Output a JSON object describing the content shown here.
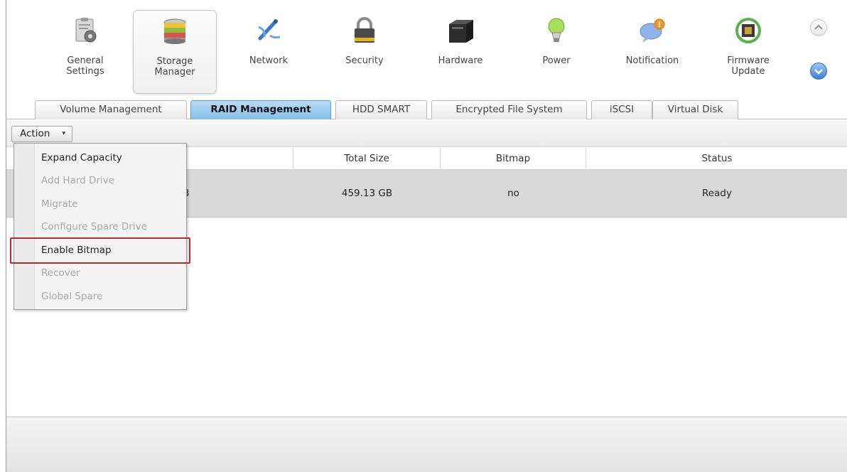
{
  "toolbar": {
    "items": [
      {
        "label": "General\nSettings",
        "icon": "settings-clipboard-icon"
      },
      {
        "label": "Storage\nManager",
        "icon": "storage-disks-icon"
      },
      {
        "label": "Network",
        "icon": "network-satellite-icon"
      },
      {
        "label": "Security",
        "icon": "padlock-icon"
      },
      {
        "label": "Hardware",
        "icon": "hardware-server-icon"
      },
      {
        "label": "Power",
        "icon": "lightbulb-icon"
      },
      {
        "label": "Notification",
        "icon": "speech-bubble-alert-icon"
      },
      {
        "label": "Firmware\nUpdate",
        "icon": "chip-refresh-icon"
      }
    ],
    "active_index": 1
  },
  "tabs": [
    "Volume Management",
    "RAID Management",
    "HDD SMART",
    "Encrypted File System",
    "iSCSI",
    "Virtual Disk"
  ],
  "active_tab": "RAID Management",
  "action_button": {
    "label": "Action",
    "caret": "▾"
  },
  "table": {
    "columns": [
      "Total Size",
      "Bitmap",
      "Status"
    ],
    "rows": [
      {
        "partial": "3",
        "total_size": "459.13 GB",
        "bitmap": "no",
        "status": "Ready"
      }
    ]
  },
  "action_menu": {
    "items": [
      {
        "label": "Expand Capacity",
        "enabled": true
      },
      {
        "label": "Add Hard Drive",
        "enabled": false
      },
      {
        "label": "Migrate",
        "enabled": false
      },
      {
        "label": "Configure Spare Drive",
        "enabled": false
      },
      {
        "label": "Enable Bitmap",
        "enabled": true,
        "highlighted": true
      },
      {
        "label": "Recover",
        "enabled": false
      },
      {
        "label": "Global Spare",
        "enabled": false
      }
    ]
  },
  "colors": {
    "active_tab": "#82bfe9",
    "highlight": "#b8292f",
    "disabled_text": "#a9a9a9"
  }
}
